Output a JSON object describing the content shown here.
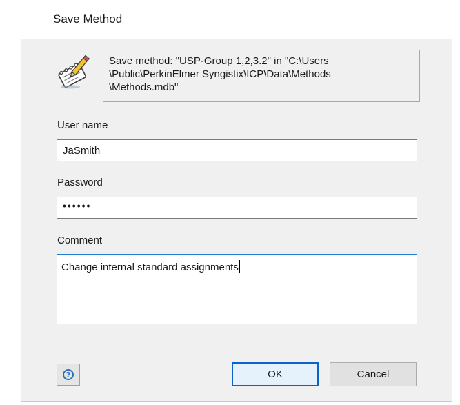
{
  "dialog": {
    "title": "Save Method",
    "message": "Save method: \"USP-Group 1,2,3.2\" in \"C:\\Users\n\\Public\\PerkinElmer Syngistix\\ICP\\Data\\Methods\n\\Methods.mdb\"",
    "icon": "notepad-pencil-icon"
  },
  "form": {
    "username_label": "User name",
    "username_value": "JaSmith",
    "password_label": "Password",
    "password_mask": "••••••",
    "comment_label": "Comment",
    "comment_value": "Change internal standard assignments"
  },
  "buttons": {
    "help_label": "?",
    "ok_label": "OK",
    "cancel_label": "Cancel"
  },
  "colors": {
    "focus_border": "#1f7dd2",
    "default_button_border": "#0a64c8"
  }
}
